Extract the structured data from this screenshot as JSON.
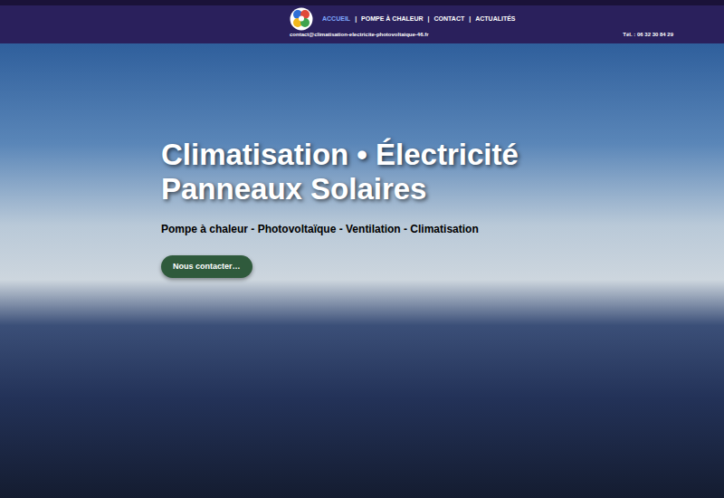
{
  "header": {
    "nav": [
      {
        "label": "ACCUEIL",
        "selected": true
      },
      {
        "label": "POMPE À CHALEUR",
        "selected": false
      },
      {
        "label": "CONTACT",
        "selected": false
      },
      {
        "label": "ACTUALITÉS",
        "selected": false
      }
    ],
    "separator": "|",
    "email": "contact@climatisation-electricite-photovoltaique-46.fr",
    "phone": "Tél. : 06 32 30 84 29"
  },
  "hero": {
    "title_lines": [
      "Climatisation • Électricité",
      "Panneaux Solaires"
    ],
    "subtitle": "Pompe à chaleur - Photovoltaïque - Ventilation - Climatisation",
    "button": "Nous contacter…"
  }
}
